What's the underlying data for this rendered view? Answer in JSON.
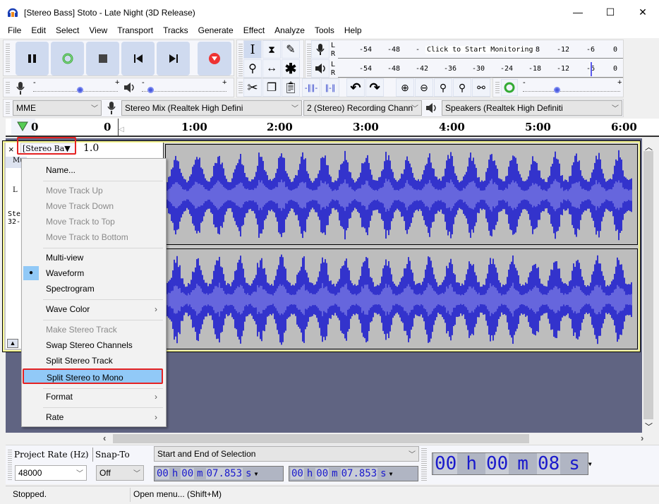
{
  "window": {
    "title": "[Stereo Bass] Stoto - Late Night (3D Release)",
    "app_icon": "audacity-headphones-icon",
    "controls": {
      "minimize": "—",
      "maximize": "☐",
      "close": "✕"
    }
  },
  "menubar": {
    "items": [
      "File",
      "Edit",
      "Select",
      "View",
      "Transport",
      "Tracks",
      "Generate",
      "Effect",
      "Analyze",
      "Tools",
      "Help"
    ]
  },
  "transport": {
    "buttons": [
      "pause",
      "loop",
      "stop",
      "skip-to-start",
      "skip-to-end",
      "record"
    ]
  },
  "tools": {
    "row1": [
      "selection-tool",
      "envelope-tool",
      "draw-tool"
    ],
    "row2": [
      "zoom-tool",
      "time-shift-tool",
      "multi-tool"
    ],
    "active": "selection-tool"
  },
  "meters": {
    "record_ticks": [
      "-54",
      "-48",
      "-",
      "8",
      "-12",
      "-6",
      "0"
    ],
    "record_prompt": "Click to Start Monitoring",
    "playback_ticks": [
      "-54",
      "-48",
      "-42",
      "-36",
      "-30",
      "-24",
      "-18",
      "-12",
      "-6",
      "0"
    ],
    "channel_l": "L",
    "channel_r": "R"
  },
  "mixer": {
    "minus": "-",
    "plus": "+",
    "record_volume": 0.55,
    "playback_volume": 0.1
  },
  "edit_toolbar": {
    "buttons": [
      "cut",
      "copy",
      "paste",
      "trim-audio",
      "silence-audio",
      "undo",
      "redo",
      "zoom-in",
      "zoom-out",
      "fit-selection",
      "fit-project",
      "zoom-toggle"
    ]
  },
  "play_at_speed": {
    "minus": "-",
    "plus": "+",
    "speed": 0.35
  },
  "device": {
    "host": "MME",
    "recording_device": "Stereo Mix (Realtek High Defini",
    "channels": "2 (Stereo) Recording Chann",
    "playback_device": "Speakers (Realtek High Definiti"
  },
  "ruler": {
    "labels": [
      "0",
      "0",
      "1:00",
      "2:00",
      "3:00",
      "4:00",
      "5:00",
      "6:00"
    ]
  },
  "track": {
    "close": "×",
    "name": "[Stereo Ba▼",
    "gain_label": "1.0",
    "mute_partial": "Mu",
    "info_partial_1": "Ste",
    "info_partial_2": "32-",
    "l_label": "L",
    "collapse": "▲"
  },
  "context_menu": {
    "items": [
      {
        "label": "Name...",
        "disabled": false
      },
      {
        "label": "Move Track Up",
        "disabled": true
      },
      {
        "label": "Move Track Down",
        "disabled": true
      },
      {
        "label": "Move Track to Top",
        "disabled": true
      },
      {
        "label": "Move Track to Bottom",
        "disabled": true
      },
      {
        "label": "Multi-view",
        "disabled": false
      },
      {
        "label": "Waveform",
        "disabled": false,
        "checked": true
      },
      {
        "label": "Spectrogram",
        "disabled": false
      },
      {
        "label": "Wave Color",
        "disabled": false,
        "submenu": true
      },
      {
        "label": "Make Stereo Track",
        "disabled": true
      },
      {
        "label": "Swap Stereo Channels",
        "disabled": false
      },
      {
        "label": "Split Stereo Track",
        "disabled": false
      },
      {
        "label": "Split Stereo to Mono",
        "disabled": false,
        "highlighted": true
      },
      {
        "label": "Format",
        "disabled": false,
        "submenu": true
      },
      {
        "label": "Rate",
        "disabled": false,
        "submenu": true
      }
    ],
    "submenu_arrow": "›"
  },
  "selection_toolbar": {
    "project_rate_label": "Project Rate (Hz)",
    "snap_to_label": "Snap-To",
    "project_rate": "48000",
    "snap_to": "Off",
    "selection_mode": "Start and End of Selection",
    "start_time": {
      "h": "00",
      "m": "00",
      "s": "07.853"
    },
    "end_time": {
      "h": "00",
      "m": "00",
      "s": "07.853"
    },
    "h_unit": "h",
    "m_unit": "m",
    "s_unit": "s"
  },
  "audio_position": {
    "h": "00",
    "m": "00",
    "s": "08",
    "h_unit": "h",
    "m_unit": "m",
    "s_unit": "s"
  },
  "status": {
    "state": "Stopped.",
    "hint": "Open menu... (Shift+M)"
  },
  "colors": {
    "wave_dark": "#3333cc",
    "wave_light": "#6666dd",
    "highlight_box": "#e52222",
    "menu_highlight": "#91c9f7",
    "track_background": "#606482"
  }
}
